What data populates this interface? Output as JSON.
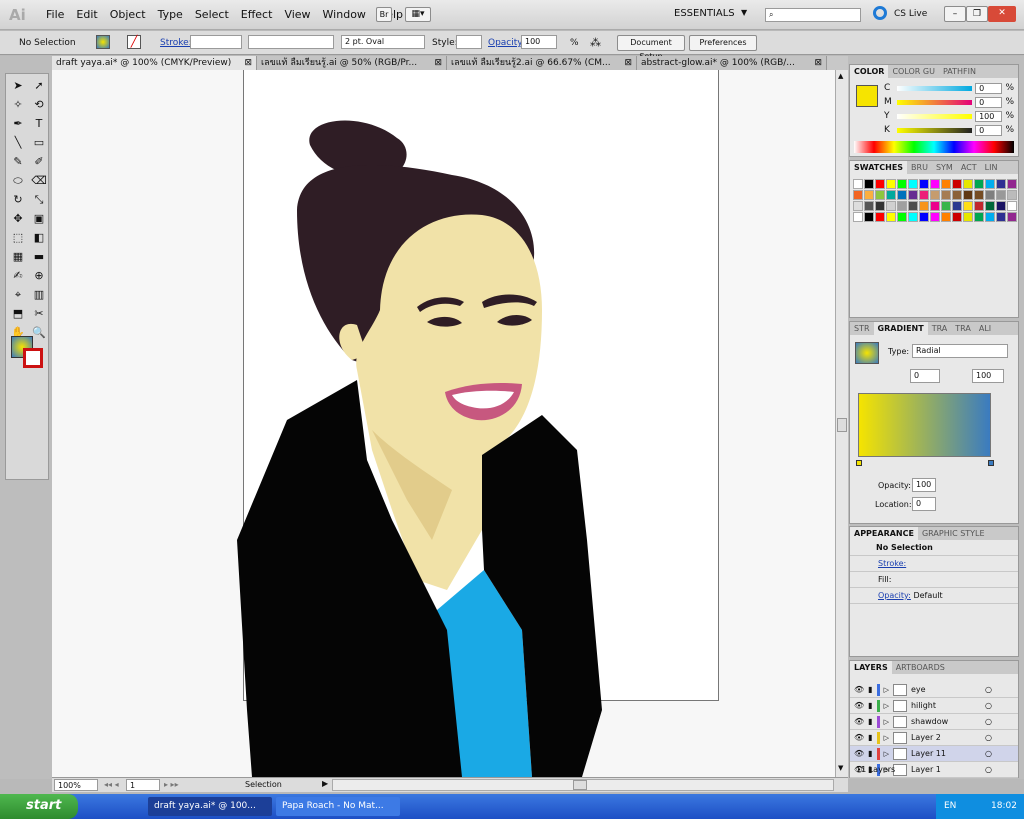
{
  "app": {
    "logo": "Ai",
    "menus": [
      "File",
      "Edit",
      "Object",
      "Type",
      "Select",
      "Effect",
      "View",
      "Window",
      "Help"
    ],
    "bridge": "Br",
    "workspace": "ESSENTIALS",
    "search_placeholder": "",
    "cslive": "CS Live"
  },
  "control": {
    "selection": "No Selection",
    "stroke_label": "Stroke:",
    "brush": "2 pt. Oval",
    "style_label": "Style:",
    "opacity_label": "Opacity:",
    "opacity_value": "100",
    "percent": "%",
    "doc_setup": "Document Setup",
    "preferences": "Preferences"
  },
  "doc_tabs": [
    "draft yaya.ai* @ 100% (CMYK/Preview)",
    "เลขแท้ ลืมเรียนรู้.ai @ 50% (RGB/Pr...",
    "เลขแท้ ลืมเรียนรู้2.ai @ 66.67% (CM...",
    "abstract-glow.ai* @ 100% (RGB/..."
  ],
  "status": {
    "zoom": "100%",
    "page": "1",
    "tool": "Selection"
  },
  "color_panel": {
    "tabs": [
      "COLOR",
      "COLOR GU",
      "PATHFIN"
    ],
    "channels": [
      {
        "k": "C",
        "v": "0"
      },
      {
        "k": "M",
        "v": "0"
      },
      {
        "k": "Y",
        "v": "100"
      },
      {
        "k": "K",
        "v": "0"
      }
    ],
    "percent": "%",
    "fill": "#f6e400"
  },
  "swatches_panel": {
    "tabs": [
      "SWATCHES",
      "BRU",
      "SYM",
      "ACT",
      "LIN"
    ]
  },
  "gradient_panel": {
    "tabs": [
      "STR",
      "GRADIENT",
      "TRA",
      "TRA",
      "ALI"
    ],
    "type_label": "Type:",
    "type_value": "Radial",
    "angle": "0",
    "ratio": "100",
    "percent": "%",
    "opacity_label": "Opacity:",
    "opacity_value": "100",
    "location_label": "Location:",
    "location_value": "0",
    "stop_start": "#f5e400",
    "stop_end": "#3a7bc0"
  },
  "appearance_panel": {
    "tabs": [
      "APPEARANCE",
      "GRAPHIC STYLE"
    ],
    "title": "No Selection",
    "stroke": "Stroke:",
    "fill": "Fill:",
    "opacity": "Opacity:",
    "opacity_value": "Default"
  },
  "layers_panel": {
    "tabs": [
      "LAYERS",
      "ARTBOARDS"
    ],
    "layers": [
      {
        "name": "eye",
        "color": "#3c6ee0"
      },
      {
        "name": "hilight",
        "color": "#3bb04c"
      },
      {
        "name": "shawdow",
        "color": "#9c4bd6"
      },
      {
        "name": "Layer 2",
        "color": "#e6c31a"
      },
      {
        "name": "Layer 11",
        "color": "#e04040"
      },
      {
        "name": "Layer 1",
        "color": "#3c6ee0"
      }
    ],
    "count": "11 Layers"
  },
  "taskbar": {
    "start": "start",
    "tasks": [
      "draft yaya.ai* @ 100...",
      "Papa Roach - No Mat..."
    ],
    "lang": "EN",
    "clock": "18:02"
  }
}
